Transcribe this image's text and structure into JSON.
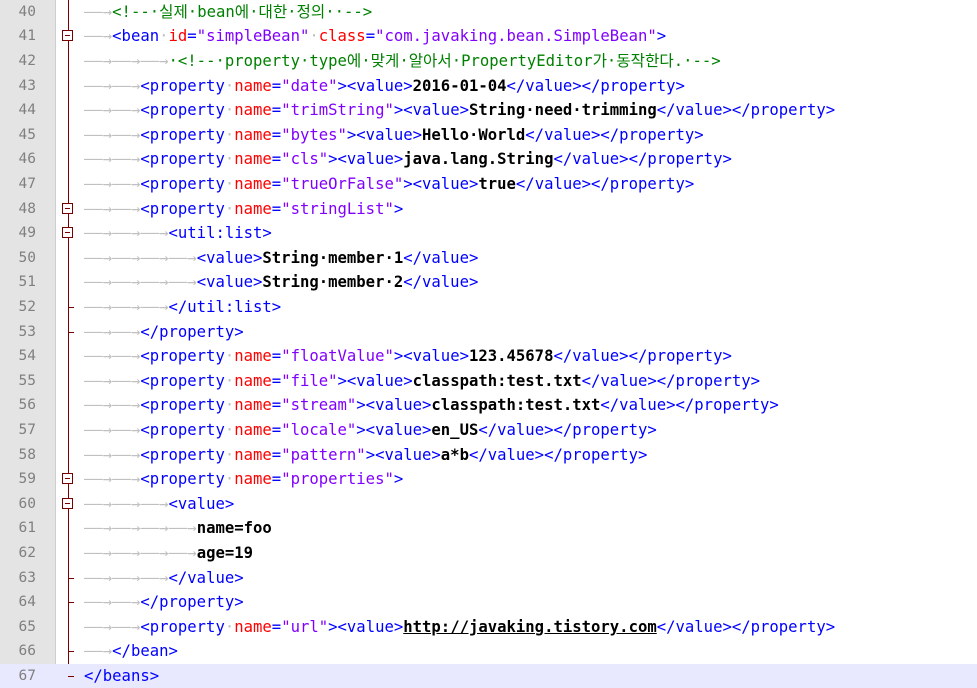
{
  "editor": {
    "colors": {
      "tag": "#0000ff",
      "attribute": "#ff0000",
      "attribute_value": "#8000ff",
      "comment": "#008000",
      "text": "#000000",
      "whitespace_marker": "#c0c0c0",
      "gutter": "#e4e4e4",
      "fold_marker": "#7a0000",
      "current_line": "#e8e8ff"
    },
    "whitespace_symbols": {
      "tab": "——→",
      "space": "·"
    },
    "current_line": 67,
    "lines": [
      {
        "num": "40",
        "indent": 1,
        "fold": "line",
        "tokens": [
          {
            "t": "cmt",
            "v": "<!--·실제·bean에·대한·정의··-->"
          }
        ]
      },
      {
        "num": "41",
        "indent": 1,
        "fold": "open",
        "tokens": [
          {
            "t": "tag",
            "v": "<bean"
          },
          {
            "t": "ws",
            "v": "·"
          },
          {
            "t": "attr",
            "v": "id"
          },
          {
            "t": "tag",
            "v": "="
          },
          {
            "t": "val",
            "v": "\"simpleBean\""
          },
          {
            "t": "ws",
            "v": "·"
          },
          {
            "t": "attr",
            "v": "class"
          },
          {
            "t": "tag",
            "v": "="
          },
          {
            "t": "val",
            "v": "\"com.javaking.bean.SimpleBean\""
          },
          {
            "t": "tag",
            "v": ">"
          }
        ]
      },
      {
        "num": "42",
        "indent": 3,
        "fold": "line",
        "tokens": [
          {
            "t": "cmt",
            "v": "·<!--·property·type에·맞게·알아서·PropertyEditor가·동작한다.·-->"
          }
        ]
      },
      {
        "num": "43",
        "indent": 2,
        "fold": "line",
        "tokens": [
          {
            "t": "tag",
            "v": "<property"
          },
          {
            "t": "ws",
            "v": "·"
          },
          {
            "t": "attr",
            "v": "name"
          },
          {
            "t": "tag",
            "v": "="
          },
          {
            "t": "val",
            "v": "\"date\""
          },
          {
            "t": "tag",
            "v": "><value>"
          },
          {
            "t": "txt",
            "v": "2016-01-04"
          },
          {
            "t": "tag",
            "v": "</value></property>"
          }
        ]
      },
      {
        "num": "44",
        "indent": 2,
        "fold": "line",
        "tokens": [
          {
            "t": "tag",
            "v": "<property"
          },
          {
            "t": "ws",
            "v": "·"
          },
          {
            "t": "attr",
            "v": "name"
          },
          {
            "t": "tag",
            "v": "="
          },
          {
            "t": "val",
            "v": "\"trimString\""
          },
          {
            "t": "tag",
            "v": "><value>"
          },
          {
            "t": "txt",
            "v": "String·need·trimming"
          },
          {
            "t": "tag",
            "v": "</value></property>"
          }
        ]
      },
      {
        "num": "45",
        "indent": 2,
        "fold": "line",
        "tokens": [
          {
            "t": "tag",
            "v": "<property"
          },
          {
            "t": "ws",
            "v": "·"
          },
          {
            "t": "attr",
            "v": "name"
          },
          {
            "t": "tag",
            "v": "="
          },
          {
            "t": "val",
            "v": "\"bytes\""
          },
          {
            "t": "tag",
            "v": "><value>"
          },
          {
            "t": "txt",
            "v": "Hello·World"
          },
          {
            "t": "tag",
            "v": "</value></property>"
          }
        ]
      },
      {
        "num": "46",
        "indent": 2,
        "fold": "line",
        "tokens": [
          {
            "t": "tag",
            "v": "<property"
          },
          {
            "t": "ws",
            "v": "·"
          },
          {
            "t": "attr",
            "v": "name"
          },
          {
            "t": "tag",
            "v": "="
          },
          {
            "t": "val",
            "v": "\"cls\""
          },
          {
            "t": "tag",
            "v": "><value>"
          },
          {
            "t": "txt",
            "v": "java.lang.String"
          },
          {
            "t": "tag",
            "v": "</value></property>"
          }
        ]
      },
      {
        "num": "47",
        "indent": 2,
        "fold": "line",
        "tokens": [
          {
            "t": "tag",
            "v": "<property"
          },
          {
            "t": "ws",
            "v": "·"
          },
          {
            "t": "attr",
            "v": "name"
          },
          {
            "t": "tag",
            "v": "="
          },
          {
            "t": "val",
            "v": "\"trueOrFalse\""
          },
          {
            "t": "tag",
            "v": "><value>"
          },
          {
            "t": "txt",
            "v": "true"
          },
          {
            "t": "tag",
            "v": "</value></property>"
          }
        ]
      },
      {
        "num": "48",
        "indent": 2,
        "fold": "open",
        "tokens": [
          {
            "t": "tag",
            "v": "<property"
          },
          {
            "t": "ws",
            "v": "·"
          },
          {
            "t": "attr",
            "v": "name"
          },
          {
            "t": "tag",
            "v": "="
          },
          {
            "t": "val",
            "v": "\"stringList\""
          },
          {
            "t": "tag",
            "v": ">"
          }
        ]
      },
      {
        "num": "49",
        "indent": 3,
        "fold": "open",
        "tokens": [
          {
            "t": "tag",
            "v": "<util:list>"
          }
        ]
      },
      {
        "num": "50",
        "indent": 4,
        "fold": "line",
        "tokens": [
          {
            "t": "tag",
            "v": "<value>"
          },
          {
            "t": "txt",
            "v": "String·member·1"
          },
          {
            "t": "tag",
            "v": "</value>"
          }
        ]
      },
      {
        "num": "51",
        "indent": 4,
        "fold": "line",
        "tokens": [
          {
            "t": "tag",
            "v": "<value>"
          },
          {
            "t": "txt",
            "v": "String·member·2"
          },
          {
            "t": "tag",
            "v": "</value>"
          }
        ]
      },
      {
        "num": "52",
        "indent": 3,
        "fold": "end",
        "tokens": [
          {
            "t": "tag",
            "v": "</util:list>"
          }
        ]
      },
      {
        "num": "53",
        "indent": 2,
        "fold": "end",
        "tokens": [
          {
            "t": "tag",
            "v": "</property>"
          }
        ]
      },
      {
        "num": "54",
        "indent": 2,
        "fold": "line",
        "tokens": [
          {
            "t": "tag",
            "v": "<property"
          },
          {
            "t": "ws",
            "v": "·"
          },
          {
            "t": "attr",
            "v": "name"
          },
          {
            "t": "tag",
            "v": "="
          },
          {
            "t": "val",
            "v": "\"floatValue\""
          },
          {
            "t": "tag",
            "v": "><value>"
          },
          {
            "t": "txt",
            "v": "123.45678"
          },
          {
            "t": "tag",
            "v": "</value></property>"
          }
        ]
      },
      {
        "num": "55",
        "indent": 2,
        "fold": "line",
        "tokens": [
          {
            "t": "tag",
            "v": "<property"
          },
          {
            "t": "ws",
            "v": "·"
          },
          {
            "t": "attr",
            "v": "name"
          },
          {
            "t": "tag",
            "v": "="
          },
          {
            "t": "val",
            "v": "\"file\""
          },
          {
            "t": "tag",
            "v": "><value>"
          },
          {
            "t": "txt",
            "v": "classpath:test.txt"
          },
          {
            "t": "tag",
            "v": "</value></property>"
          }
        ]
      },
      {
        "num": "56",
        "indent": 2,
        "fold": "line",
        "tokens": [
          {
            "t": "tag",
            "v": "<property"
          },
          {
            "t": "ws",
            "v": "·"
          },
          {
            "t": "attr",
            "v": "name"
          },
          {
            "t": "tag",
            "v": "="
          },
          {
            "t": "val",
            "v": "\"stream\""
          },
          {
            "t": "tag",
            "v": "><value>"
          },
          {
            "t": "txt",
            "v": "classpath:test.txt"
          },
          {
            "t": "tag",
            "v": "</value></property>"
          }
        ]
      },
      {
        "num": "57",
        "indent": 2,
        "fold": "line",
        "tokens": [
          {
            "t": "tag",
            "v": "<property"
          },
          {
            "t": "ws",
            "v": "·"
          },
          {
            "t": "attr",
            "v": "name"
          },
          {
            "t": "tag",
            "v": "="
          },
          {
            "t": "val",
            "v": "\"locale\""
          },
          {
            "t": "tag",
            "v": "><value>"
          },
          {
            "t": "txt",
            "v": "en_US"
          },
          {
            "t": "tag",
            "v": "</value></property>"
          }
        ]
      },
      {
        "num": "58",
        "indent": 2,
        "fold": "line",
        "tokens": [
          {
            "t": "tag",
            "v": "<property"
          },
          {
            "t": "ws",
            "v": "·"
          },
          {
            "t": "attr",
            "v": "name"
          },
          {
            "t": "tag",
            "v": "="
          },
          {
            "t": "val",
            "v": "\"pattern\""
          },
          {
            "t": "tag",
            "v": "><value>"
          },
          {
            "t": "txt",
            "v": "a*b"
          },
          {
            "t": "tag",
            "v": "</value></property>"
          }
        ]
      },
      {
        "num": "59",
        "indent": 2,
        "fold": "open",
        "tokens": [
          {
            "t": "tag",
            "v": "<property"
          },
          {
            "t": "ws",
            "v": "·"
          },
          {
            "t": "attr",
            "v": "name"
          },
          {
            "t": "tag",
            "v": "="
          },
          {
            "t": "val",
            "v": "\"properties\""
          },
          {
            "t": "tag",
            "v": ">"
          }
        ]
      },
      {
        "num": "60",
        "indent": 3,
        "fold": "open",
        "tokens": [
          {
            "t": "tag",
            "v": "<value>"
          }
        ]
      },
      {
        "num": "61",
        "indent": 4,
        "fold": "line",
        "tokens": [
          {
            "t": "txt",
            "v": "name=foo"
          }
        ]
      },
      {
        "num": "62",
        "indent": 4,
        "fold": "line",
        "tokens": [
          {
            "t": "txt",
            "v": "age=19"
          }
        ]
      },
      {
        "num": "63",
        "indent": 3,
        "fold": "end",
        "tokens": [
          {
            "t": "tag",
            "v": "</value>"
          }
        ]
      },
      {
        "num": "64",
        "indent": 2,
        "fold": "end",
        "tokens": [
          {
            "t": "tag",
            "v": "</property>"
          }
        ]
      },
      {
        "num": "65",
        "indent": 2,
        "fold": "line",
        "tokens": [
          {
            "t": "tag",
            "v": "<property"
          },
          {
            "t": "ws",
            "v": "·"
          },
          {
            "t": "attr",
            "v": "name"
          },
          {
            "t": "tag",
            "v": "="
          },
          {
            "t": "val",
            "v": "\"url\""
          },
          {
            "t": "tag",
            "v": "><value>"
          },
          {
            "t": "link",
            "v": "http://javaking.tistory.com"
          },
          {
            "t": "tag",
            "v": "</value></property>"
          }
        ]
      },
      {
        "num": "66",
        "indent": 1,
        "fold": "end",
        "tokens": [
          {
            "t": "tag",
            "v": "</bean>"
          }
        ]
      },
      {
        "num": "67",
        "indent": 0,
        "fold": "end",
        "tokens": [
          {
            "t": "tag",
            "v": "</beans>"
          }
        ]
      }
    ]
  }
}
